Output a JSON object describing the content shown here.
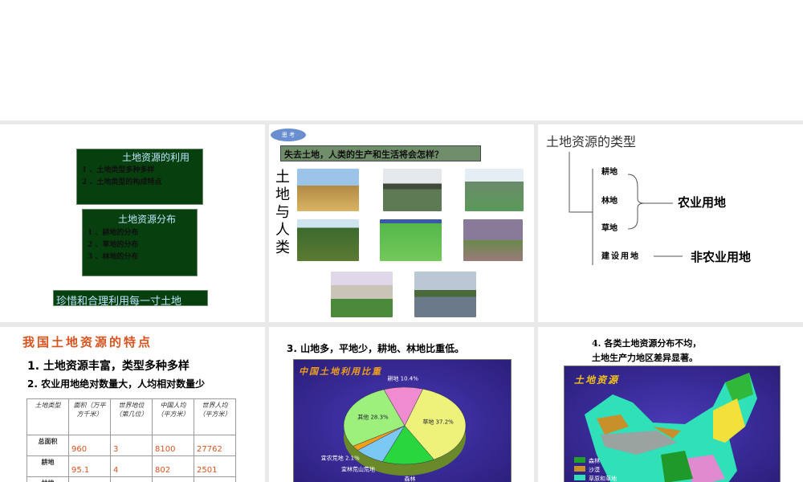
{
  "slide1": {
    "box1_title": "土地资源的利用",
    "box1_items": [
      "1 、土地类型多种多样",
      "2 、土地类型的构成特点"
    ],
    "box2_title": "土地资源分布",
    "box2_items": [
      "1 、耕地的分布",
      "2 、草地的分布",
      "3 、林地的分布"
    ],
    "banner": "珍惜和合理利用每一寸土地"
  },
  "slide2": {
    "bubble": "思 考",
    "question": "失去土地，人类的生产和生活将会怎样？",
    "side_title": "土地与人类"
  },
  "slide3": {
    "title": "土地资源的类型",
    "items": [
      "耕地",
      "林地",
      "草地",
      "建设用地"
    ],
    "agri": "农业用地",
    "nonagri": "非农业用地"
  },
  "slide4": {
    "title": "我国土地资源的特点",
    "point1": "1. 土地资源丰富，类型多种多样",
    "point2": "2. 农业用地绝对数量大，人均相对数量少",
    "table": {
      "headers": [
        "土地类型",
        "面积（万平方千米）",
        "世界地位（第几位）",
        "中国人均（平方米）",
        "世界人均（平方米）"
      ],
      "rows": [
        [
          "总面积",
          "960",
          "3",
          "8100",
          "27762"
        ],
        [
          "耕地",
          "95.1",
          "4",
          "802",
          "2501"
        ],
        [
          "林地",
          "",
          "",
          "",
          ""
        ]
      ]
    }
  },
  "slide5": {
    "title": "3. 山地多，平地少，耕地、林地比重低。",
    "chart_title": "中国土地利用比重"
  },
  "slide6": {
    "title_line1": "4. 各类土地资源分布不均，",
    "title_line2": "土地生产力地区差异显著。",
    "map_title": "土地资源",
    "legend": [
      "森林",
      "沙漠",
      "草原和草地"
    ]
  },
  "chart_data": {
    "type": "pie",
    "title": "中国土地利用比重",
    "slices": [
      {
        "label": "耕地",
        "value": 10.4,
        "text": "耕地 10.4%",
        "color": "#f08bd0"
      },
      {
        "label": "草地",
        "value": 37.2,
        "text": "草地 37.2%",
        "color": "#eef27a"
      },
      {
        "label": "森林",
        "value": 13.9,
        "text": "森林",
        "color": "#29d63e"
      },
      {
        "label": "宜林荒山荒地",
        "value": 8.1,
        "text": "宜林荒山荒地",
        "color": "#7cc8f5"
      },
      {
        "label": "宜农荒地",
        "value": 2.1,
        "text": "宜农荒地 2.1%",
        "color": "#f2a01a"
      },
      {
        "label": "其他",
        "value": 28.3,
        "text": "其他 28.3%",
        "color": "#9ef07d"
      }
    ]
  }
}
